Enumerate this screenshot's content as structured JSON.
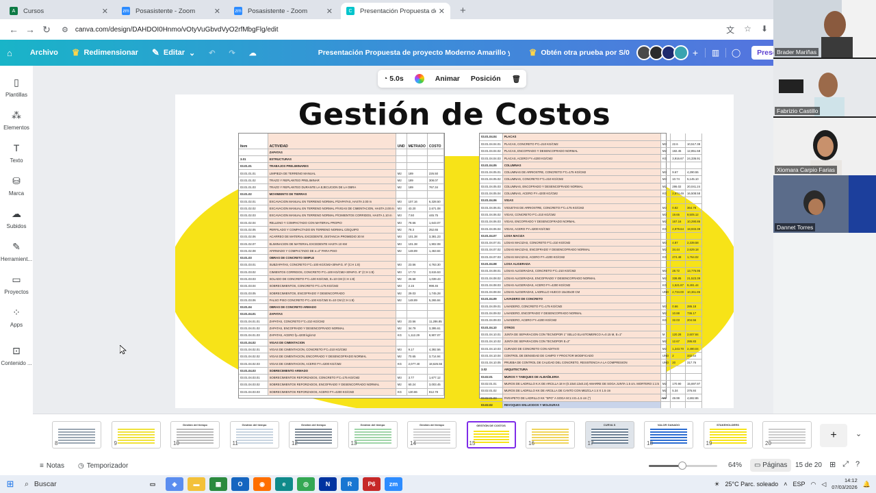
{
  "browser": {
    "tabs": [
      {
        "label": "Cursos",
        "icon": "canvas-lms-icon",
        "color": "#0d7a45",
        "active": false
      },
      {
        "label": "Posasistente - Zoom",
        "icon": "zoom-icon",
        "color": "#2d8cff",
        "active": false
      },
      {
        "label": "Posasistente - Zoom",
        "icon": "zoom-icon",
        "color": "#2d8cff",
        "active": false
      },
      {
        "label": "Presentación Propuesta de proy",
        "icon": "canva-icon",
        "color": "#00c4cc",
        "active": true
      }
    ],
    "url": "canva.com/design/DAHDOI0Hnmo/vOtyVuGbvdVyO2rfMbgFlg/edit"
  },
  "canva_header": {
    "archivo": "Archivo",
    "redimensionar": "Redimensionar",
    "editar": "Editar",
    "doc_title": "Presentación Propuesta de proyecto Moderno Amarillo y n...",
    "trial": "Obtén otra prueba por S/0",
    "share": "Presentar"
  },
  "sidebar": [
    {
      "label": "Plantillas",
      "icon": "templates-icon"
    },
    {
      "label": "Elementos",
      "icon": "elements-icon"
    },
    {
      "label": "Texto",
      "icon": "text-icon"
    },
    {
      "label": "Marca",
      "icon": "brand-icon"
    },
    {
      "label": "Subidos",
      "icon": "uploads-icon"
    },
    {
      "label": "Herramient...",
      "icon": "tools-icon"
    },
    {
      "label": "Proyectos",
      "icon": "projects-icon"
    },
    {
      "label": "Apps",
      "icon": "apps-icon"
    },
    {
      "label": "Contenido ...",
      "icon": "content-icon"
    }
  ],
  "context_toolbar": {
    "duration": "5.0s",
    "animate": "Animar",
    "position": "Posición"
  },
  "slide": {
    "title": "Gestión de Costos",
    "accent_color": "#f7e318",
    "left_sheet": {
      "headers": [
        "Item",
        "ACTIVIDAD",
        "UND",
        "METRADO",
        "COSTO"
      ],
      "rows": [
        [
          "",
          "ZAPATAS",
          "",
          "",
          ""
        ],
        [
          "3.01",
          "ESTRUCTURAS",
          "",
          "",
          ""
        ],
        [
          "03.01.01",
          "TRABAJOS PRELIMINARES",
          "",
          "",
          ""
        ],
        [
          "03.01.01.01",
          "LIMPIEZA DE TERRENO MANUAL",
          "M2",
          "189",
          "226.50"
        ],
        [
          "03.01.01.02",
          "TRAZO Y REPLANTEO PRELIMINAR",
          "M2",
          "189",
          "308.07"
        ],
        [
          "03.01.01.03",
          "TRAZO Y REPLANTEO DURANTE LA EJECUCION DE LA OBRA",
          "M2",
          "189",
          "767.34"
        ],
        [
          "03.01.02",
          "MOVIMIENTO DE TIERRAS",
          "",
          "",
          ""
        ],
        [
          "03.01.02.01",
          "EXCAVACION MANUAL EN TERRENO NORMAL P/ZAPATAS, HASTA 2.00 m",
          "M3",
          "107.16",
          "6,328.50"
        ],
        [
          "03.01.02.02",
          "EXCAVACION MANUAL EN TERRENO NORMAL P/VIGAS DE CIMENTACION, HASTA 2.00 m",
          "M3",
          "43.20",
          "2,671.08"
        ],
        [
          "03.01.02.03",
          "EXCAVACION MANUAL EN TERRENO NORMAL P/CIMIENTOS CORRIDOS, HASTA 1.10 m",
          "M3",
          "7.50",
          "445.75"
        ],
        [
          "03.01.02.04",
          "RELLENO Y COMPACTADO CON MATERIAL PROPIO",
          "M3",
          "78.66",
          "1,643.07"
        ],
        [
          "03.01.02.05",
          "PERFILADO Y COMPACTADO EN TERRENO NORMAL C/EQUIPO",
          "M2",
          "78.3",
          "252.65"
        ],
        [
          "03.01.02.06",
          "ACARREO DE MATERIAL EXCEDENTE, DISTANCIA PROMEDIO 30 M",
          "M3",
          "101.38",
          "3,381.23"
        ],
        [
          "03.01.02.07",
          "ELIMINACION DE MATERIAL EXCEDENTE HASTA 10 KM",
          "M3",
          "101.38",
          "1,902.08"
        ],
        [
          "03.01.02.08",
          "AFIRMADO Y COMPACTADO DE e=4\" PARA PISO",
          "M2",
          "148.89",
          "1,463.84"
        ],
        [
          "03.01.03",
          "OBRAS DE CONCRETO SIMPLE",
          "",
          "",
          ""
        ],
        [
          "03.01.03.01",
          "SUBZAPATAS, CONCRETO F'C=100 KG/CM2+30%P.G. 8\" (C:H 1:8)",
          "M3",
          "23.56",
          "4,763.30"
        ],
        [
          "03.01.03.02",
          "CIMIENTOS CORRIDOS, CONCRETO F'C=100 KG/CM2+30%P.G. 8\" (C:H 1:8)",
          "M3",
          "17.72",
          "3,615.53"
        ],
        [
          "03.01.03.03",
          "SOLADO DE CONCRETO F'C=100 KG/CM2, E=10 CM (C:H 1:8)",
          "M2",
          "26.68",
          "1,039.43"
        ],
        [
          "03.01.03.04",
          "SOBRECIMIENTOS, CONCRETO F'C=175 KG/CM2",
          "M3",
          "2.15",
          "998.46"
        ],
        [
          "03.01.03.05",
          "SOBRECIMIENTOS, ENCOFRADO Y DESENCOFRADO",
          "M2",
          "29.03",
          "1,745.28"
        ],
        [
          "03.01.03.06",
          "FALSO PISO CONCRETO F'C=100 KG/CM2 E=10 CM (C:H 1:8)",
          "M2",
          "148.89",
          "5,265.84"
        ],
        [
          "03.01.04",
          "OBRAS DE CONCRETO ARMADO",
          "",
          "",
          ""
        ],
        [
          "03.01.04.01",
          "ZAPATAS",
          "",
          "",
          ""
        ],
        [
          "03.01.04.01.01",
          "ZAPATAS, CONCRETO F'C=210 KG/CM2",
          "M3",
          "23.56",
          "11,286.85"
        ],
        [
          "03.01.04.01.02",
          "ZAPATAS, ENCOFRADO Y DESENCOFRADO NORMAL",
          "M2",
          "34.79",
          "3,395.61"
        ],
        [
          "03.01.04.01.03",
          "ZAPATAS, ACERO fy=4200 kg/cm2",
          "KG",
          "1,112.29",
          "9,907.07"
        ],
        [
          "03.01.04.02",
          "VIGAS DE CIMENTACION",
          "",
          "",
          ""
        ],
        [
          "03.01.04.02.01",
          "VIGAS DE CIMENTACION, CONCRETO F'C=210 KG/CM2",
          "M3",
          "9.17",
          "4,392.56"
        ],
        [
          "03.01.04.02.02",
          "VIGAS DE CIMENTACION, ENCOFRADO Y DESENCOFRADO NORMAL",
          "M2",
          "70.65",
          "3,714.94"
        ],
        [
          "03.01.04.02.03",
          "VIGAS DE CIMENTACION, ACERO FY=4200 KG/CM2",
          "KG",
          "2,077.40",
          "18,626.56"
        ],
        [
          "03.01.04.03",
          "SOBRECIMIENTO ARMADO",
          "",
          "",
          ""
        ],
        [
          "03.01.04.03.01",
          "SOBRECIMIENTOS REFORZADOS, CONCRETO F'C=175 KG/CM2",
          "M3",
          "3.77",
          "1,677.12"
        ],
        [
          "03.01.04.03.02",
          "SOBRECIMIENTOS REFORZADOS, ENCOFRADO Y DESENCOFRADO NORMAL",
          "M2",
          "60.24",
          "3,003.45"
        ],
        [
          "03.01.04.03.03",
          "SOBRECIMIENTOS REFORZADOS, ACERO FY=4200 KG/CM2",
          "KG",
          "130.86",
          "812.78"
        ]
      ]
    },
    "right_sheet": {
      "rows": [
        [
          "03.01.04.04",
          "PLACAS",
          "",
          "",
          ""
        ],
        [
          "03.01.04.04.01",
          "PLACAS, CONCRETO F'C=210 KG/CM2",
          "M3",
          "22.6",
          "10,517.38"
        ],
        [
          "03.01.04.04.02",
          "PLACAS, ENCOFRADO Y DESENCOFRADO NORMAL",
          "M2",
          "182.45",
          "12,851.58"
        ],
        [
          "03.01.04.04.03",
          "PLACAS, ACERO FY=4200 KG/CM2",
          "KG",
          "3,916.67",
          "24,336.91"
        ],
        [
          "03.01.04.05",
          "COLUMNAS",
          "",
          "",
          ""
        ],
        [
          "03.01.04.05.01",
          "COLUMNAS DE ARRIOSTRE, CONCRETO F'C=175 KG/CM2",
          "M3",
          "9.67",
          "4,290.55"
        ],
        [
          "03.01.04.05.02",
          "COLUMNAS, CONCRETO F'C=210 KG/CM2",
          "M3",
          "10.74",
          "5,145.10"
        ],
        [
          "03.01.04.05.03",
          "COLUMNAS, ENCOFRADO Y DESENCOFRADO NORMAL",
          "M2",
          "286.02",
          "20,041.24"
        ],
        [
          "03.01.04.05.04",
          "COLUMNAS, ACERO FY=4200 KG/CM2",
          "KG",
          "2,674.49",
          "16,508.58"
        ],
        [
          "03.01.04.06",
          "VIGAS",
          "",
          "",
          ""
        ],
        [
          "03.01.04.06.01",
          "VIGUETAS DE ARRIOSTRE, CONCRETO F'C=175 KG/CM2",
          "M3",
          "0.82",
          "364.78"
        ],
        [
          "03.01.04.06.02",
          "VIGAS, CONCRETO F'C=210 KG/CM2",
          "M3",
          "19.65",
          "9,505.12"
        ],
        [
          "03.01.04.06.03",
          "VIGAS, ENCOFRADO Y DESENCOFRADO NORMAL",
          "M2",
          "167.16",
          "10,290.86"
        ],
        [
          "03.01.04.06.04",
          "VIGAS, ACERO FY=4200 KG/CM2",
          "KG",
          "2,979.64",
          "18,933.39"
        ],
        [
          "03.01.04.07",
          "LOSA MACIZA",
          "",
          "",
          ""
        ],
        [
          "03.01.04.07.01",
          "LOSAS MACIZAS, CONCRETO F'C=210 KG/CM2",
          "M3",
          "4.87",
          "2,339.58"
        ],
        [
          "03.01.04.07.02",
          "LOSAS MACIZAS, ENCOFRADO Y DESENCOFRADO NORMAL",
          "M2",
          "34.44",
          "2,629.18"
        ],
        [
          "03.01.04.07.03",
          "LOSAS MACIZAS, ACERO FY=4200 KG/CM2",
          "KG",
          "274.48",
          "1,764.02"
        ],
        [
          "03.01.04.08",
          "LOSA ALIGERADA",
          "",
          "",
          ""
        ],
        [
          "03.01.04.08.01",
          "LOSAS ALIGERADAS, CONCRETO F'C=210 KG/CM2",
          "M3",
          "28.72",
          "13,776.95"
        ],
        [
          "03.01.04.08.02",
          "LOSAS ALIGERADAS, ENCOFRADO Y DESENCOFRADO NORMAL",
          "M2",
          "338.85",
          "21,523.39"
        ],
        [
          "03.01.04.08.03",
          "LOSAS ALIGERADAS, ACERO FY=4200 KG/CM2",
          "KG",
          "1,521.87",
          "9,491.44"
        ],
        [
          "03.01.04.08.04",
          "LOSAS ALIGERADAS, LADRILLO HUECO 15x30x30 CM",
          "UND",
          "2,734.00",
          "10,361.86"
        ],
        [
          "03.01.04.09",
          "LAVADERO DE CONCRETO",
          "",
          "",
          ""
        ],
        [
          "03.01.04.09.01",
          "LAVADERO, CONCRETO F'C=175 KG/CM2",
          "M3",
          "0.66",
          "286.18"
        ],
        [
          "03.01.04.09.02",
          "LAVADERO, ENCOFRADO Y DESENCOFRADO NORMAL",
          "M2",
          "10.88",
          "736.17"
        ],
        [
          "03.01.04.09.03",
          "LAVADERO, ACERO FY=4200 KG/CM2",
          "KG",
          "32.03",
          "204.56"
        ],
        [
          "03.01.04.10",
          "OTROS",
          "",
          "",
          ""
        ],
        [
          "03.01.04.10.01",
          "JUNTA DE SEPARACION CON TECNOPOR 1\" SELLO ELASTOMERICO A=0.15 M, E=1\"",
          "M",
          "120.28",
          "2,607.84"
        ],
        [
          "03.01.04.10.02",
          "JUNTA DE SEPARACION CON TECNOPOR E=2\"",
          "M2",
          "12.67",
          "286.83"
        ],
        [
          "03.01.04.10.03",
          "CURADO DE CONCRETO CON ADITIVO",
          "M2",
          "1,243.70",
          "2,490.04"
        ],
        [
          "03.01.04.10.04",
          "CONTROL DE DENSIDAD DE CAMPO Y PROCTOR MODIFICADO",
          "UND",
          "2",
          "332.54"
        ],
        [
          "03.01.04.10.05",
          "PRUEBA DE CONTROL DE CALIDAD DEL CONCRETO, RESISTENCIA A LA COMPRESION",
          "UND",
          "20",
          "317.76"
        ],
        [
          "3.02",
          "ARQUITECTURA",
          "",
          "",
          ""
        ],
        [
          "03.02.01",
          "MUROS Y TABIQUES DE ALBAÑILERIA",
          "",
          "",
          ""
        ],
        [
          "03.02.01.01",
          "MUROS DE LADRILLO K.K DE ARCILLA 18 H (0.10x0.13x0.24) AMARRE DE SOGA JUNTA 1.5 cm. MORTERO 1:1:5",
          "M2",
          "170.90",
          "15,697.97"
        ],
        [
          "03.02.01.02",
          "MUROS DE LADRILLO KK DE ARCILLA DE CANTO CON MEZCLA 1:4 X 1.5 cm",
          "M2",
          "5.34",
          "376.84"
        ],
        [
          "03.02.01.03",
          "PARAPETO DE LADRILLO KK \"SPG\" A SOGA  M:1:4 E=1.5 cm (\")",
          "M2",
          "49.99",
          "4,692.86"
        ],
        [
          "03.02.02",
          "REVOQUES ENLUCIDOS Y MOLDURAS",
          "",
          "",
          ""
        ],
        [
          "03.02.02.01",
          "TARRAJEO PRIMARIO RAYADO MEZCLA 1:5 MUROS",
          "M2",
          "90.17",
          "2,396.39"
        ],
        [
          "03.02.02.02",
          "TARRAJEO PRIMARIO RAYADO MEZCLA 1:5 COLUMNAS",
          "M2",
          "6.80",
          "281.79"
        ]
      ]
    }
  },
  "filmstrip": {
    "thumbs": [
      {
        "num": "8",
        "title": ""
      },
      {
        "num": "9",
        "title": ""
      },
      {
        "num": "10",
        "title": "Gestión del tiempo"
      },
      {
        "num": "11",
        "title": "Gestión del tiempo"
      },
      {
        "num": "12",
        "title": "Gestión del tiempo"
      },
      {
        "num": "13",
        "title": "Gestión del tiempo"
      },
      {
        "num": "14",
        "title": "Gestión del tiempo"
      },
      {
        "num": "15",
        "title": "GESTIÓN DE COSTOS"
      },
      {
        "num": "16",
        "title": ""
      },
      {
        "num": "17",
        "title": "CURVA S"
      },
      {
        "num": "18",
        "title": "VALOR GANADO"
      },
      {
        "num": "19",
        "title": "STAKEHOLDERS"
      },
      {
        "num": "20",
        "title": ""
      }
    ],
    "active_index": 7
  },
  "bottom_bar": {
    "notes": "Notas",
    "timer": "Temporizador",
    "zoom_level": 64,
    "zoom_label": "64%",
    "pages": "Páginas",
    "page_count": "15 de 20"
  },
  "zoom_participants": [
    {
      "name": "Brader Mariñas"
    },
    {
      "name": "Fabrizio Castillo"
    },
    {
      "name": "Xiomara Carpio Farias"
    },
    {
      "name": "Dannet Torres"
    }
  ],
  "taskbar": {
    "search": "Buscar",
    "weather": "25°C  Parc. soleado",
    "lang": "ESP",
    "time": "14:12",
    "date": "07/03/2026"
  }
}
